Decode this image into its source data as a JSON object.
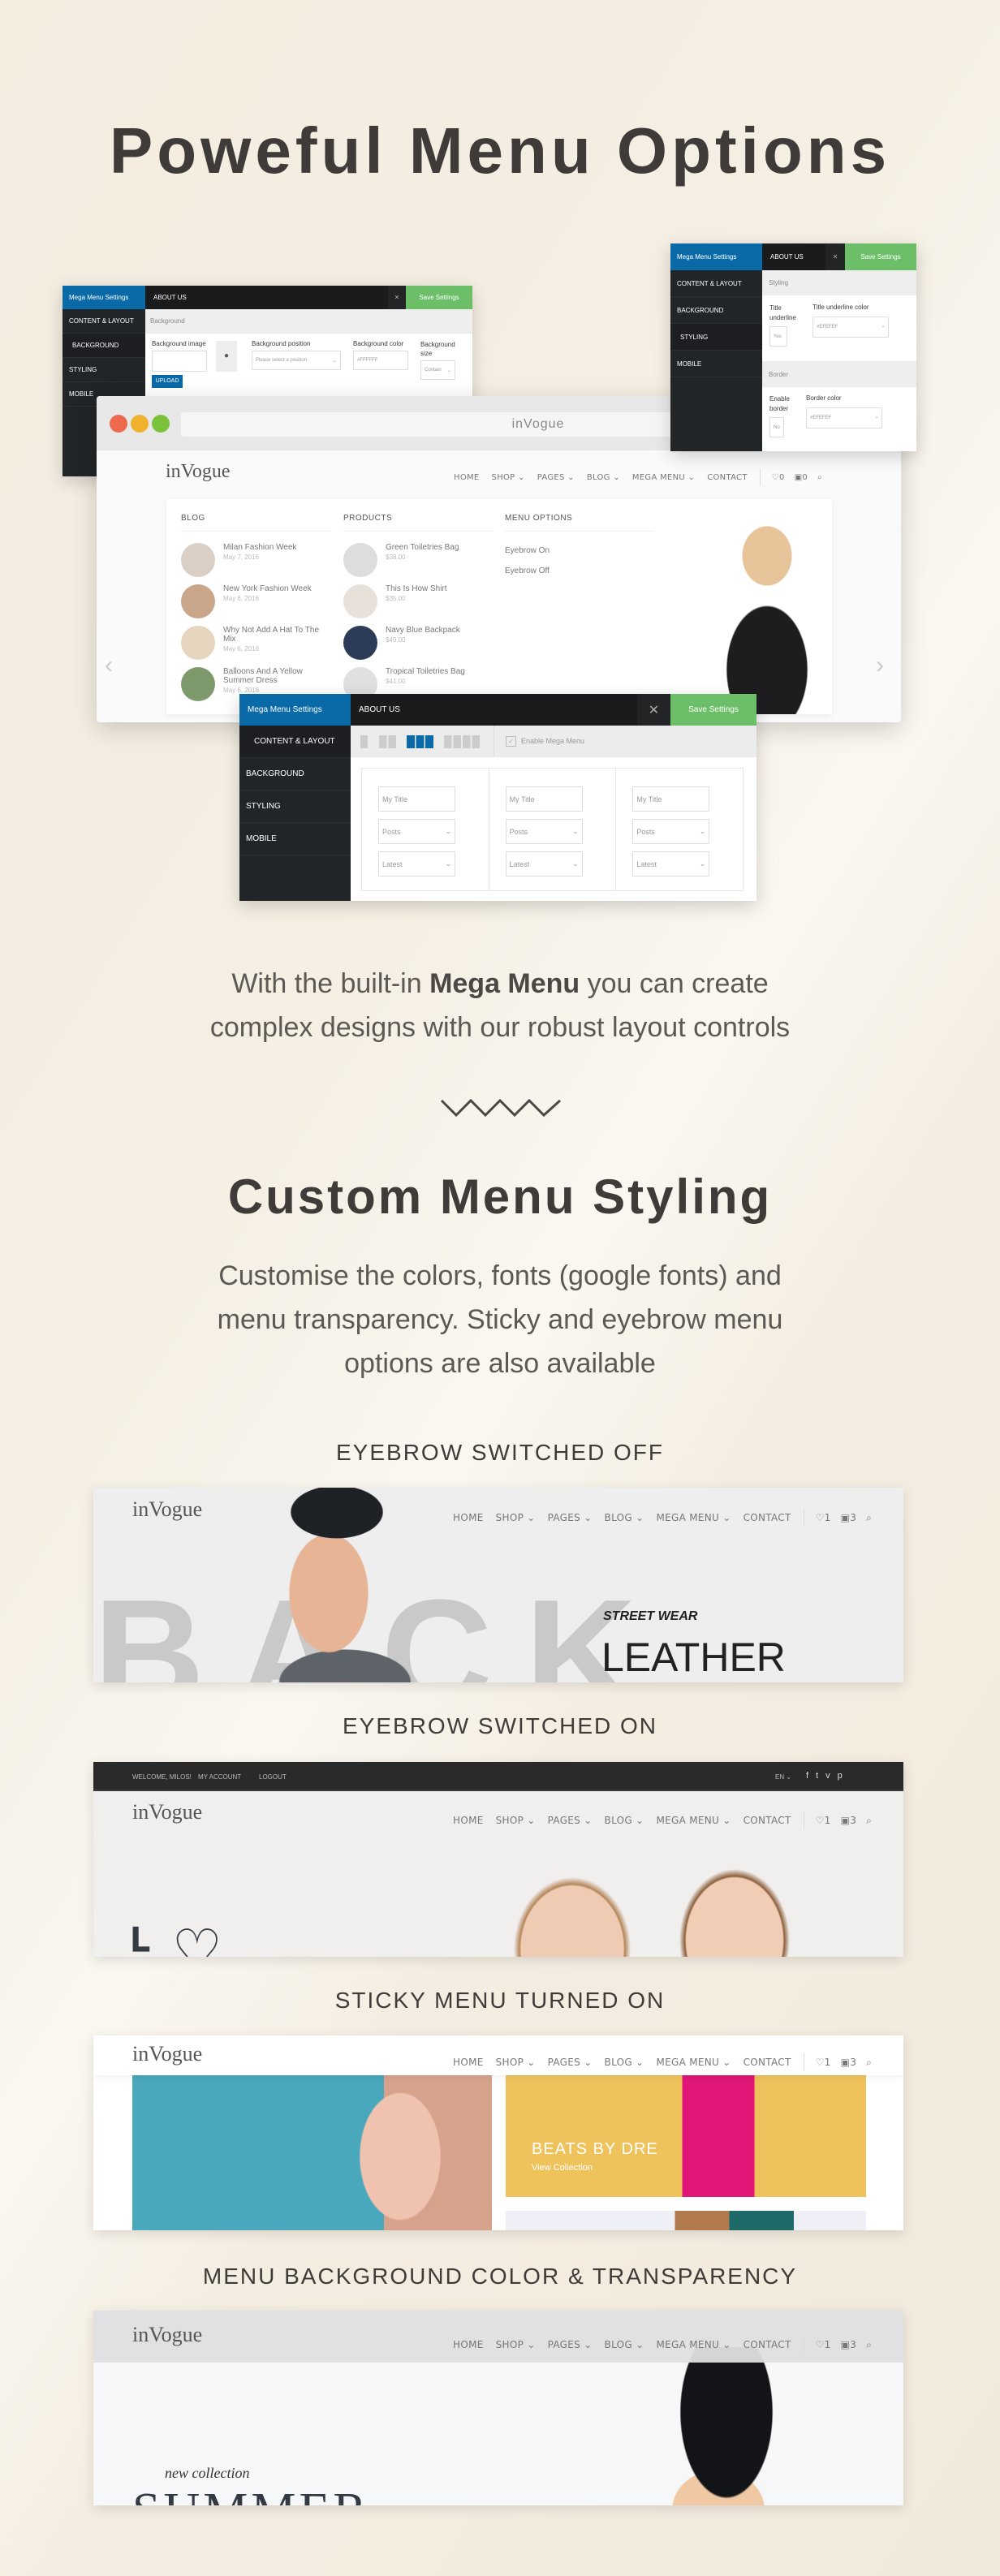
{
  "hero": {
    "title": "Poweful Menu Options",
    "description_pre": "With the built-in ",
    "description_bold": "Mega Menu",
    "description_post": " you can create",
    "description_line2": "complex designs with our robust layout controls"
  },
  "styling": {
    "title": "Custom Menu Styling",
    "lines": [
      "Customise the colors, fonts (google fonts) and",
      "menu transparency. Sticky and eyebrow menu",
      "options are also available"
    ]
  },
  "panel": {
    "brand": "Mega Menu Settings",
    "menu_item": "ABOUT US",
    "save": "Save Settings",
    "sidebar": [
      "CONTENT & LAYOUT",
      "BACKGROUND",
      "STYLING",
      "MOBILE"
    ]
  },
  "bg_panel": {
    "section": "Background",
    "bg_image": "Background image",
    "upload": "UPLOAD",
    "bg_position": "Background position",
    "position_placeholder": "Please select a position",
    "bg_color": "Background color",
    "bg_color_value": "#FFFFFF",
    "bg_size": "Background size",
    "bg_size_value": "Contain"
  },
  "style_panel": {
    "section": "Styling",
    "title_underline": "Title underline",
    "title_underline_value": "Yes",
    "underline_color": "Title underline color",
    "underline_color_value": "#EFEFEF",
    "border_section": "Border",
    "enable_border": "Enable border",
    "enable_border_value": "No",
    "border_color": "Border color",
    "border_color_value": "#EFEFEF"
  },
  "layout_panel": {
    "enable": "Enable Mega Menu",
    "enabled": true,
    "selected_layout": 3,
    "columns": [
      {
        "title": "My Title",
        "type": "Posts",
        "order": "Latest"
      },
      {
        "title": "My Title",
        "type": "Posts",
        "order": "Latest"
      },
      {
        "title": "My Title",
        "type": "Posts",
        "order": "Latest"
      }
    ]
  },
  "browser": {
    "url_title": "inVogue"
  },
  "site": {
    "logo": "inVogue",
    "nav": [
      "HOME",
      "SHOP",
      "PAGES",
      "BLOG",
      "MEGA MENU",
      "CONTACT"
    ],
    "dropdown": [
      false,
      true,
      true,
      true,
      true,
      false
    ],
    "wishlist_count": "0",
    "cart_count": "0",
    "wishlist_count_alt": "1",
    "cart_count_alt": "3"
  },
  "mega": {
    "blog_heading": "BLOG",
    "products_heading": "PRODUCTS",
    "options_heading": "MENU OPTIONS",
    "blog": [
      {
        "title": "Milan Fashion Week",
        "date": "May 7, 2016"
      },
      {
        "title": "New York Fashion Week",
        "date": "May 6, 2016"
      },
      {
        "title": "Why Not Add A Hat To The Mix",
        "date": "May 6, 2016"
      },
      {
        "title": "Balloons And A Yellow Summer Dress",
        "date": "May 6, 2016"
      }
    ],
    "products": [
      {
        "title": "Green Toiletries Bag",
        "price": "$38.00"
      },
      {
        "title": "This Is How Shirt",
        "price": "$35.00"
      },
      {
        "title": "Navy Blue Backpack",
        "price": "$49.00"
      },
      {
        "title": "Tropical Toiletries Bag",
        "price": "$41.00"
      }
    ],
    "options": [
      "Eyebrow On",
      "Eyebrow Off"
    ]
  },
  "examples": [
    {
      "label": "EYEBROW SWITCHED OFF",
      "slide_small": "STREET WEAR",
      "slide_big": "LEATHER",
      "slide_bg_text": "BACK"
    },
    {
      "label": "EYEBROW SWITCHED ON",
      "eyebrow_left": [
        "WELCOME, MILOS!",
        "MY ACCOUNT",
        "LOGOUT"
      ],
      "language": "EN",
      "social": [
        "facebook-icon",
        "twitter-icon",
        "vimeo-icon",
        "pinterest-icon"
      ]
    },
    {
      "label": "STICKY MENU TURNED ON",
      "card_title": "BEATS BY DRE",
      "card_link": "View Collection"
    },
    {
      "label": "MENU BACKGROUND COLOR & TRANSPARENCY",
      "slide_small": "new collection",
      "slide_big": "SUMMER"
    }
  ],
  "colors": {
    "brand_blue": "#0a6aa8",
    "save_green": "#6cbf68",
    "panel_dark": "#1a1b1d",
    "mac_red": "#ee6a4f",
    "mac_yellow": "#f0b12f",
    "mac_green": "#7ac23c"
  }
}
